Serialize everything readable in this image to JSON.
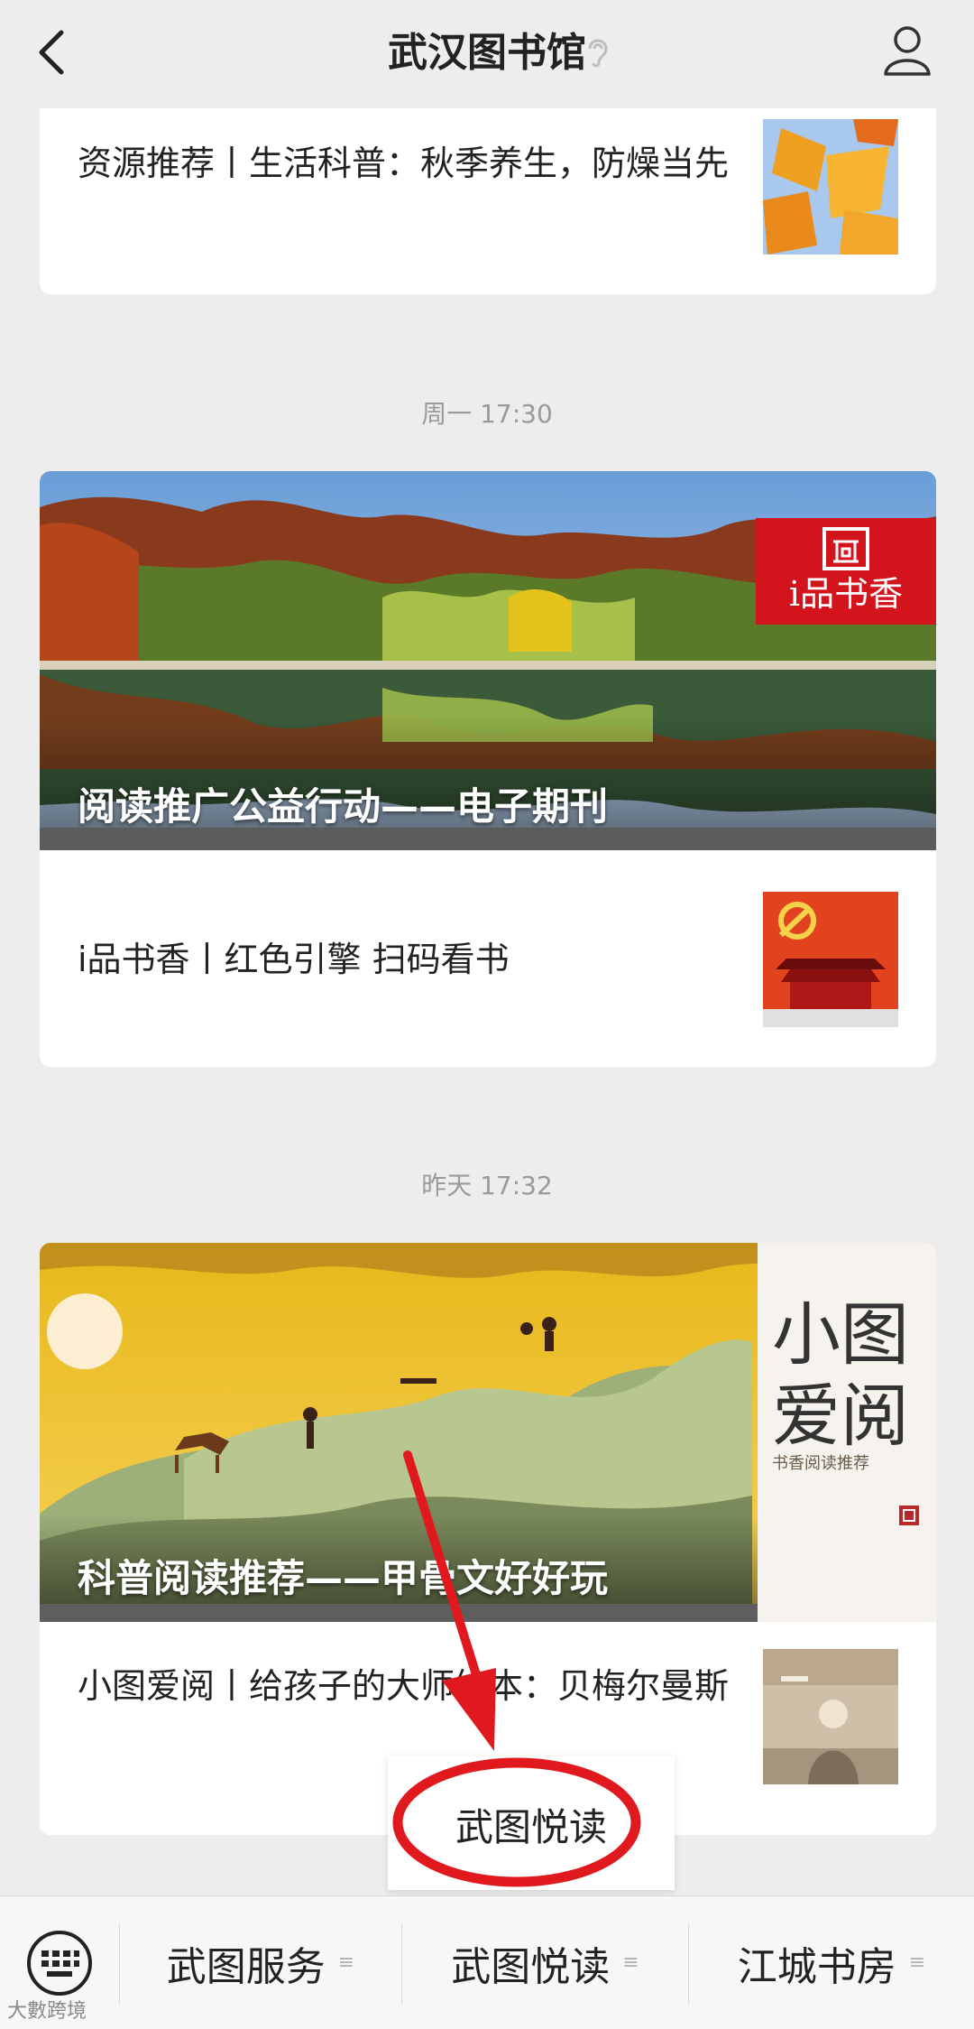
{
  "header": {
    "title": "武汉图书馆"
  },
  "feed": {
    "top_article": {
      "title": "资源推荐丨生活科普：秋季养生，防燥当先"
    },
    "group1": {
      "time": "周一 17:30",
      "banner_title": "阅读推广公益行动——电子期刊",
      "banner_tag": "i品书香",
      "article": {
        "title": "i品书香丨红色引擎 扫码看书"
      }
    },
    "group2": {
      "time": "昨天 17:32",
      "banner_title": "科普阅读推荐——甲骨文好好玩",
      "side_big_1": "小图",
      "side_big_2": "爱阅",
      "side_small": "书香阅读推荐",
      "article": {
        "title": "小图爱阅丨给孩子的大师绘本：贝梅尔曼斯"
      }
    }
  },
  "popup": {
    "label": "武图悦读"
  },
  "bottom_menu": {
    "tabs": [
      {
        "label": "武图服务"
      },
      {
        "label": "武图悦读"
      },
      {
        "label": "江城书房"
      }
    ]
  },
  "watermark": "大數跨境",
  "colors": {
    "accent_red": "#e0191e",
    "tag_red": "#d4141c"
  },
  "icons": [
    "back-arrow-icon",
    "ear-icon",
    "user-icon",
    "keyboard-icon",
    "menu-dots-icon"
  ]
}
